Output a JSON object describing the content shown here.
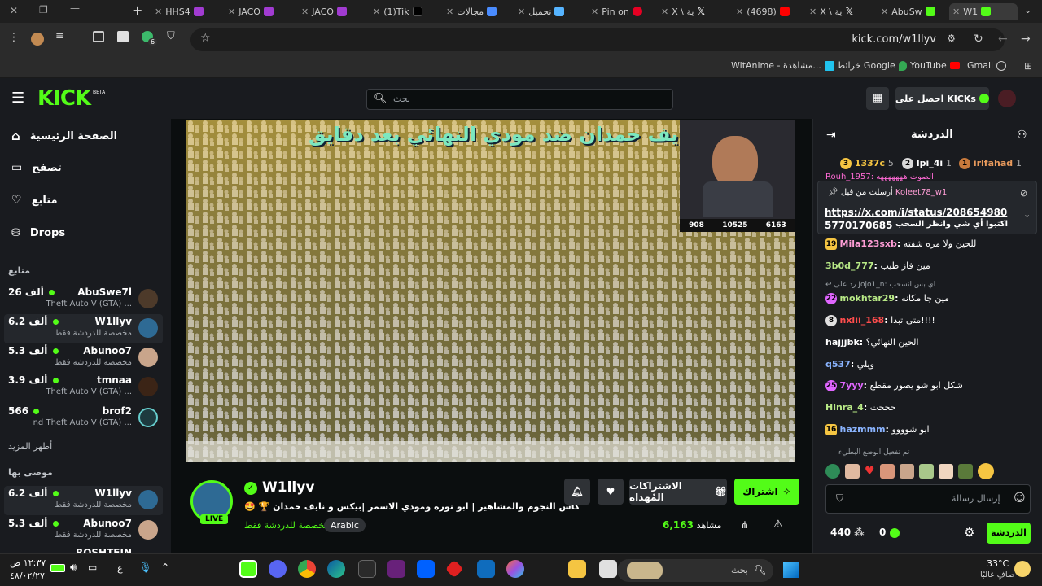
{
  "browser": {
    "tabs": [
      {
        "label": "HHS4"
      },
      {
        "label": "JACO"
      },
      {
        "label": "JACO"
      },
      {
        "label": "(1)Tik"
      },
      {
        "label": "مجالات"
      },
      {
        "label": "تحميل"
      },
      {
        "label": "Pin on"
      },
      {
        "label": "X \\ ية"
      },
      {
        "label": "(4698)"
      },
      {
        "label": "X \\ ية"
      },
      {
        "label": "AbuSw"
      },
      {
        "label": "W1"
      }
    ],
    "url": "kick.com/w1llyv",
    "extension_badge": "6",
    "bookmarks": [
      "Gmail",
      "YouTube",
      "خرائط Google",
      "WitAnime - مشاهدة..."
    ]
  },
  "kick": {
    "logo": "KICK",
    "logo_beta": "BETA",
    "search_placeholder": "بحث",
    "get_kicks": "احصل على KICKs"
  },
  "sidebar": {
    "nav": [
      {
        "label": "الصفحة الرئيسية",
        "icon": "home-icon"
      },
      {
        "label": "تصفح",
        "icon": "browse-icon"
      },
      {
        "label": "متابع",
        "icon": "heart-icon"
      },
      {
        "label": "Drops",
        "icon": "drops-icon"
      }
    ],
    "following_title": "متابع",
    "following": [
      {
        "name": "AbuSwe7l",
        "viewers": "26 ألف",
        "game": "Theft Auto V (GTA) ..."
      },
      {
        "name": "W1llyv",
        "viewers": "6.2 ألف",
        "game": "مخصصة للدردشة فقط"
      },
      {
        "name": "Abunoo7",
        "viewers": "5.3 ألف",
        "game": "مخصصة للدردشة فقط"
      },
      {
        "name": "tmnaa",
        "viewers": "3.9 ألف",
        "game": "Theft Auto V (GTA) ..."
      },
      {
        "name": "brof2",
        "viewers": "566",
        "game": "nd Theft Auto V (GTA) ..."
      }
    ],
    "show_more": "أظهر المزيد",
    "recommended_title": "موصى بها",
    "recommended": [
      {
        "name": "W1llyv",
        "viewers": "6.2 ألف",
        "game": "مخصصة للدردشة فقط"
      },
      {
        "name": "Abunoo7",
        "viewers": "5.3 ألف",
        "game": "مخصصة للدردشة فقط"
      },
      {
        "name": "ROSHTEIN",
        "viewers": "",
        "game": ""
      }
    ]
  },
  "player": {
    "overlay_title": "نايف حمدان ضد مودي النهائي بعد دقايق",
    "stat_a": "908",
    "stat_b": "10525",
    "stat_c": "6163"
  },
  "stream": {
    "channel": "W1llyv",
    "live_label": "LIVE",
    "title": "🤩 🏆 كأس النجوم والمشاهير | ابو نوره ومودي الاسمر |بيكس و نايف حمدان",
    "category": "مخصصة للدردشة فقط",
    "language": "Arabic",
    "viewers": "6,163",
    "viewers_label": "مشاهد",
    "subscribe": "اشتراك",
    "gift_subs": "الاشتراكات المُهداة"
  },
  "chat": {
    "title": "الدردشة",
    "leaders": [
      {
        "rank": "1",
        "name": "irlfahad",
        "count": "1"
      },
      {
        "rank": "2",
        "name": "lpi_4i",
        "count": "1"
      },
      {
        "rank": "3",
        "name": "1337c",
        "count": "5"
      }
    ],
    "pinned_by_label": "أرسلت من قبل",
    "pinned_by": "Koleet78_w1",
    "pinned_link": "https://x.com/i/status/2086549805770170685",
    "pinned_text": "اكتبوا أي شي وانظر السحب",
    "partial_top": "Rouh_1957: الصوت هههههههه",
    "messages": [
      {
        "badge": "19",
        "user": "Mila123sxb",
        "text": "للحين ولا مره شفته",
        "color": "#ff9dd6"
      },
      {
        "badge": "",
        "user": "3b0d_777",
        "text": "مين فاز طيب",
        "color": "#b8e986"
      },
      {
        "badge": "",
        "user": "",
        "text": "رد على Jojo1_n: اي بس انسحب",
        "color": "#9aa0a6"
      },
      {
        "badge": "22",
        "user": "mokhtar29",
        "text": "مين جا مكانه",
        "color": "#b8e986"
      },
      {
        "badge": "8",
        "user": "nxlii_168",
        "text": "متى تبدا!!!!",
        "color": "#ff4d4d"
      },
      {
        "badge": "",
        "user": "hajjjbk",
        "text": "الحين النهائي؟",
        "color": "#ffffff"
      },
      {
        "badge": "",
        "user": "q537",
        "text": "ويلي",
        "color": "#8ab4ff"
      },
      {
        "badge": "25",
        "user": "7yyy",
        "text": "شكل ابو شو يصور مقطع",
        "color": "#e066ff"
      },
      {
        "badge": "",
        "user": "Hinra_4",
        "text": "حححت",
        "color": "#b8e986"
      },
      {
        "badge": "16",
        "user": "hazmmm",
        "text": "ابو شوووو",
        "color": "#8ab4ff"
      }
    ],
    "slow_mode": "تم تفعيل الوضع البطيء",
    "input_placeholder": "إرسال رسالة",
    "points": "440",
    "kicks": "0",
    "send": "الدردشة"
  },
  "taskbar": {
    "weather_temp": "33°C",
    "weather_desc": "صافٍ غالبًا",
    "search": "بحث",
    "time": "١٢:٣٧ ص",
    "date": "٤٨/٠٢/٢٧",
    "lang": "ع"
  },
  "colors": {
    "kick_green": "#53fc18",
    "bg": "#0b0e0f",
    "panel": "#191b1f"
  }
}
